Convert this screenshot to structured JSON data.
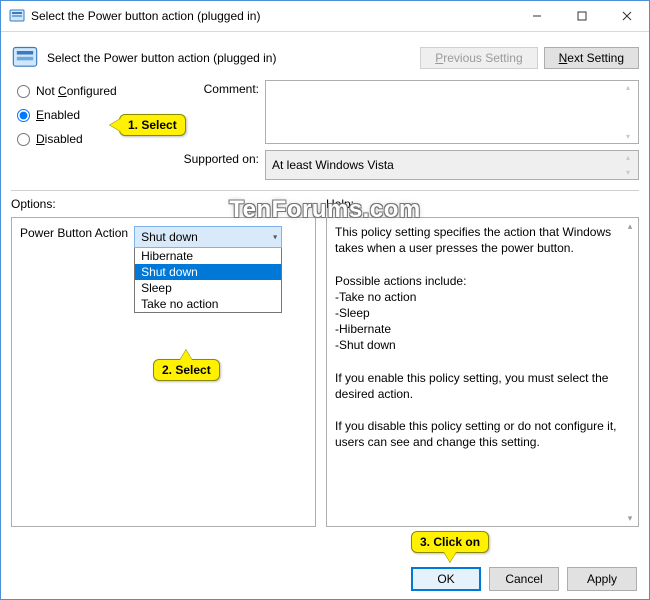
{
  "window": {
    "title": "Select the Power button action (plugged in)"
  },
  "header": {
    "title": "Select the Power button action (plugged in)",
    "prev": "Previous Setting",
    "next": "Next Setting"
  },
  "state": {
    "not_configured": "Not Configured",
    "enabled": "Enabled",
    "disabled": "Disabled",
    "selected": "enabled"
  },
  "labels": {
    "comment": "Comment:",
    "supported_on": "Supported on:",
    "options": "Options:",
    "help": "Help:"
  },
  "supported_on": "At least Windows Vista",
  "option": {
    "label": "Power Button Action",
    "selected": "Shut down",
    "items": [
      "Hibernate",
      "Shut down",
      "Sleep",
      "Take no action"
    ]
  },
  "help": {
    "p1": "This policy setting specifies the action that Windows takes when a user presses the power button.",
    "p2": "Possible actions include:",
    "a1": "-Take no action",
    "a2": "-Sleep",
    "a3": "-Hibernate",
    "a4": "-Shut down",
    "p3": "If you enable this policy setting, you must select the desired action.",
    "p4": "If you disable this policy setting or do not configure it, users can see and change this setting."
  },
  "footer": {
    "ok": "OK",
    "cancel": "Cancel",
    "apply": "Apply"
  },
  "callouts": {
    "c1": "1. Select",
    "c2": "2. Select",
    "c3": "3. Click on"
  },
  "watermark": "TenForums.com"
}
